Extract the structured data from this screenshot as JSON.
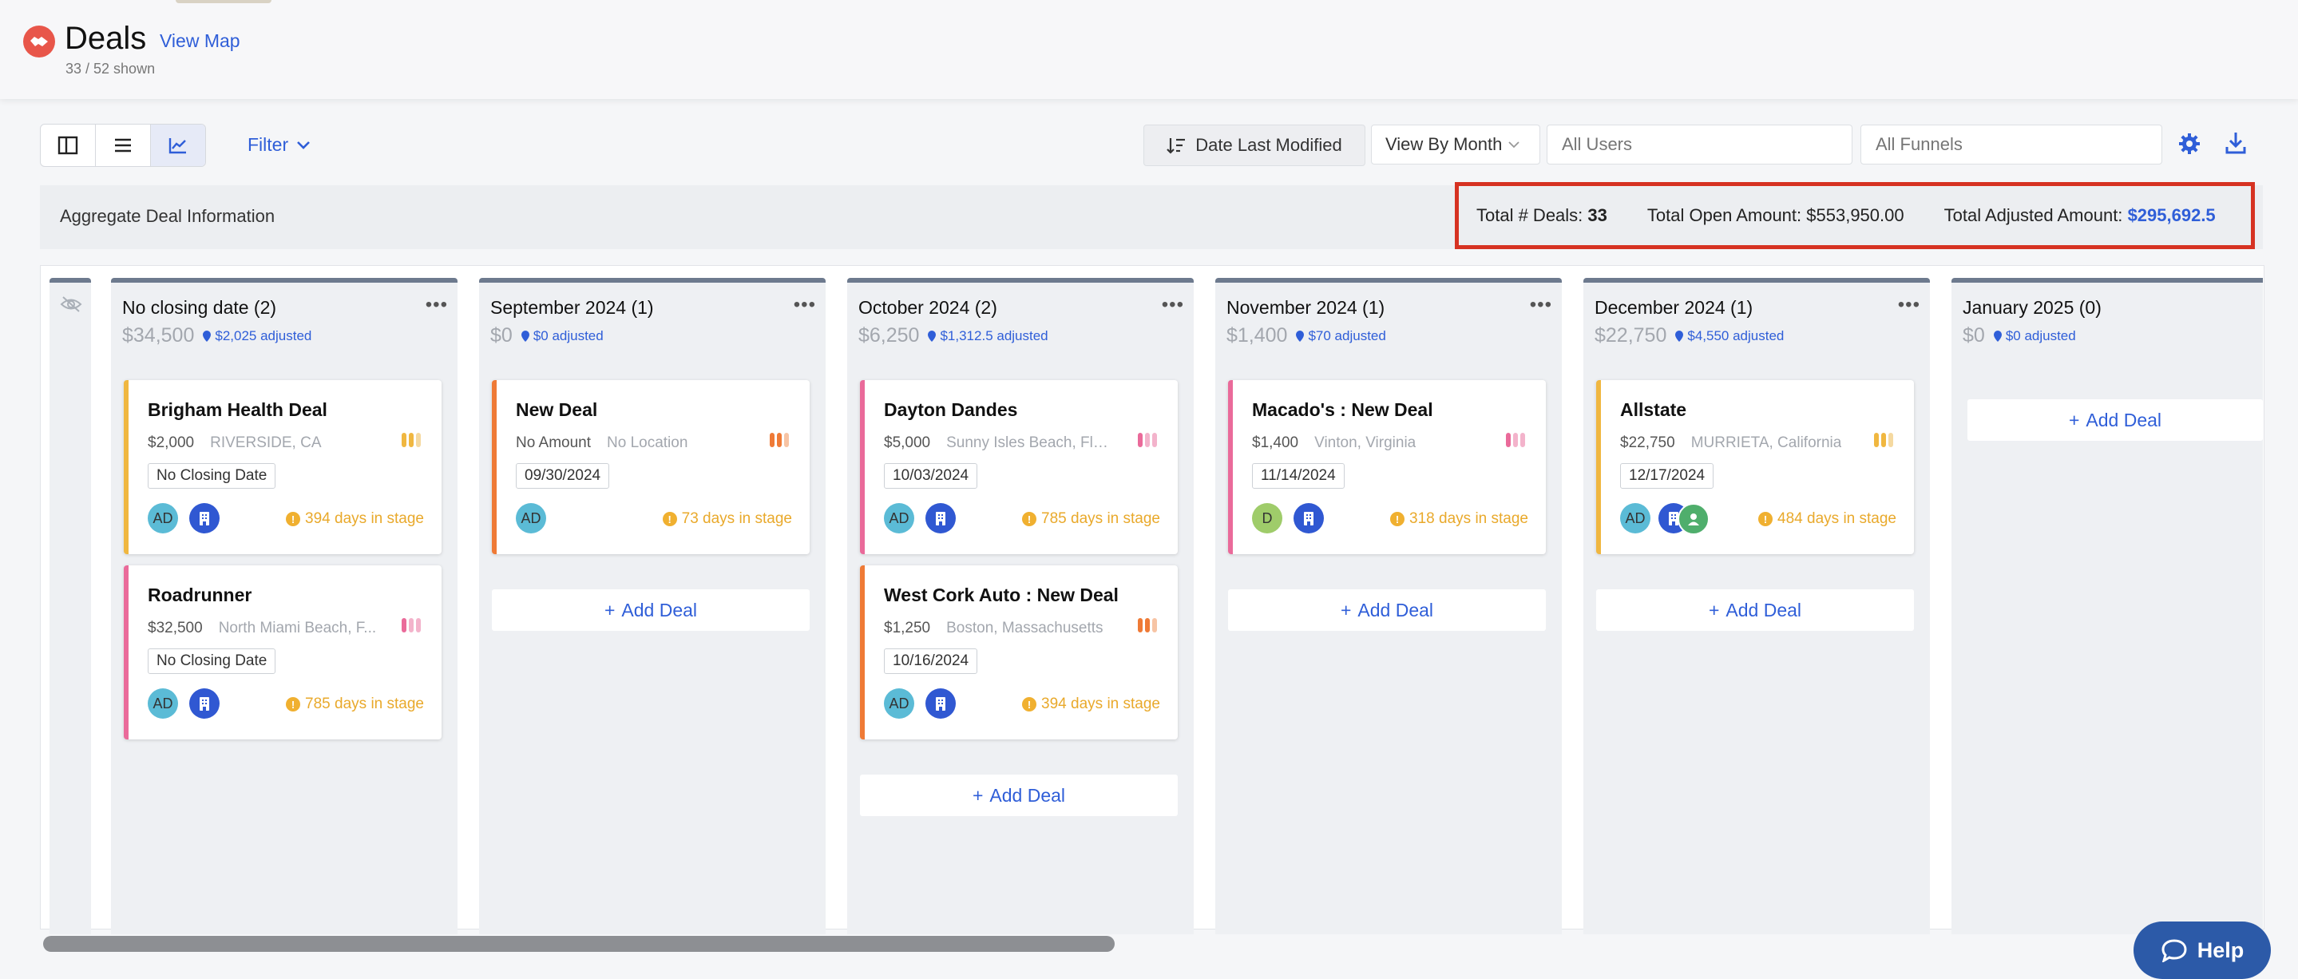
{
  "header": {
    "title": "Deals",
    "view_map": "View Map",
    "shown": "33 / 52 shown"
  },
  "toolbar": {
    "filter": "Filter",
    "sort_label": "Date Last Modified",
    "view_by": "View By Month",
    "users_placeholder": "All Users",
    "funnels_placeholder": "All Funnels"
  },
  "aggregate": {
    "label": "Aggregate Deal Information",
    "total_deals_label": "Total # Deals:",
    "total_deals": "33",
    "open_amount_label": "Total Open Amount:",
    "open_amount": "$553,950.00",
    "adjusted_label": "Total Adjusted Amount:",
    "adjusted_amount": "$295,692.5"
  },
  "add_deal": "Add Deal",
  "columns": [
    {
      "title": "No closing date (2)",
      "amount": "$34,500",
      "adjusted": "$2,025 adjusted"
    },
    {
      "title": "September 2024 (1)",
      "amount": "$0",
      "adjusted": "$0 adjusted"
    },
    {
      "title": "October 2024 (2)",
      "amount": "$6,250",
      "adjusted": "$1,312.5 adjusted"
    },
    {
      "title": "November 2024 (1)",
      "amount": "$1,400",
      "adjusted": "$70 adjusted"
    },
    {
      "title": "December 2024 (1)",
      "amount": "$22,750",
      "adjusted": "$4,550 adjusted"
    },
    {
      "title": "January 2025 (0)",
      "amount": "$0",
      "adjusted": "$0 adjusted"
    }
  ],
  "cards": [
    {
      "name": "Brigham Health Deal",
      "amount": "$2,000",
      "location": "RIVERSIDE, CA",
      "date": "No Closing Date",
      "avatar": "AD",
      "days": "394 days in stage",
      "accent": "#f0b740"
    },
    {
      "name": "Roadrunner",
      "amount": "$32,500",
      "location": "North Miami Beach, F...",
      "date": "No Closing Date",
      "avatar": "AD",
      "days": "785 days in stage",
      "accent": "#ea6a9a"
    },
    {
      "name": "New Deal",
      "amount": "No Amount",
      "location": "No Location",
      "date": "09/30/2024",
      "avatar": "AD",
      "days": "73 days in stage",
      "accent": "#ef7a36"
    },
    {
      "name": "Dayton Dandes",
      "amount": "$5,000",
      "location": "Sunny Isles Beach, Flo...",
      "date": "10/03/2024",
      "avatar": "AD",
      "days": "785 days in stage",
      "accent": "#ea6a9a"
    },
    {
      "name": "West Cork Auto : New Deal",
      "amount": "$1,250",
      "location": "Boston, Massachusetts",
      "date": "10/16/2024",
      "avatar": "AD",
      "days": "394 days in stage",
      "accent": "#ef7a36"
    },
    {
      "name": "Macado's : New Deal",
      "amount": "$1,400",
      "location": "Vinton, Virginia",
      "date": "11/14/2024",
      "avatar": "D",
      "days": "318 days in stage",
      "accent": "#ea6a9a"
    },
    {
      "name": "Allstate",
      "amount": "$22,750",
      "location": "MURRIETA, California",
      "date": "12/17/2024",
      "avatar": "AD",
      "days": "484 days in stage",
      "accent": "#f0b740"
    }
  ],
  "help": "Help",
  "icons": [
    "deals-logo-icon",
    "kanban-view-icon",
    "list-view-icon",
    "chart-view-icon",
    "chevron-down-icon",
    "sort-icon",
    "settings-gear-icon",
    "download-icon",
    "hide-eye-icon",
    "pin-icon",
    "building-icon",
    "person-icon",
    "warning-icon",
    "chat-icon"
  ]
}
